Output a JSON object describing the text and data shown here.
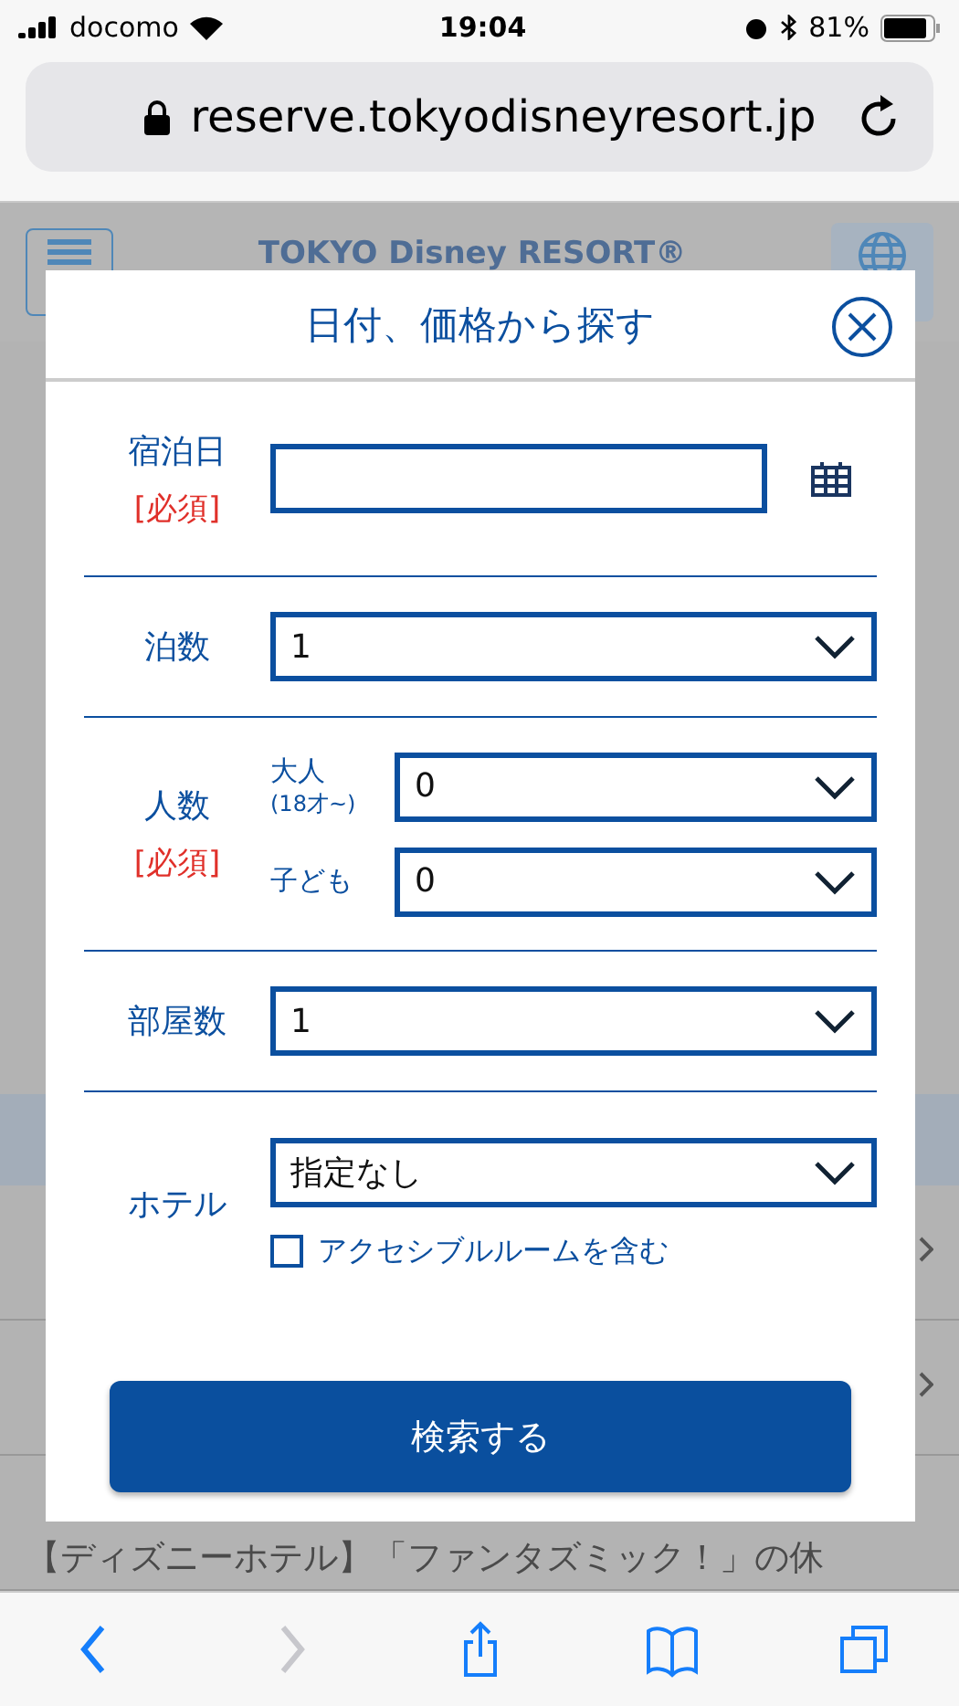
{
  "status_bar": {
    "carrier": "docomo",
    "time": "19:04",
    "battery": "81%"
  },
  "browser": {
    "url": "reserve.tokyodisneyresort.jp"
  },
  "page": {
    "logo": "TOKYO Disney RESORT®",
    "rows": [
      "【ディズニーホテル】「ファンタズミック！」の休"
    ]
  },
  "dialog": {
    "title": "日付、価格から探す",
    "fields": [
      {
        "kind": "date",
        "label": "宿泊日",
        "required": "[必須]"
      },
      {
        "kind": "select",
        "label": "泊数",
        "value": "1"
      },
      {
        "kind": "people",
        "label": "人数",
        "required": "[必須]",
        "subfields": [
          {
            "label": "大人",
            "note": "(18才~)",
            "value": "0"
          },
          {
            "label": "子ども",
            "value": "0"
          }
        ]
      },
      {
        "kind": "select",
        "label": "部屋数",
        "value": "1"
      },
      {
        "kind": "hotel",
        "label": "ホテル",
        "value": "指定なし",
        "checkbox": {
          "label": "アクセシブルルームを含む",
          "checked": false
        }
      }
    ],
    "search_button": "検索する"
  },
  "toolbar": [
    {
      "kind": "back",
      "disabled": false
    },
    {
      "kind": "forward",
      "disabled": true
    },
    {
      "kind": "share",
      "disabled": false
    },
    {
      "kind": "bookmarks",
      "disabled": false
    },
    {
      "kind": "tabs",
      "disabled": false
    }
  ]
}
